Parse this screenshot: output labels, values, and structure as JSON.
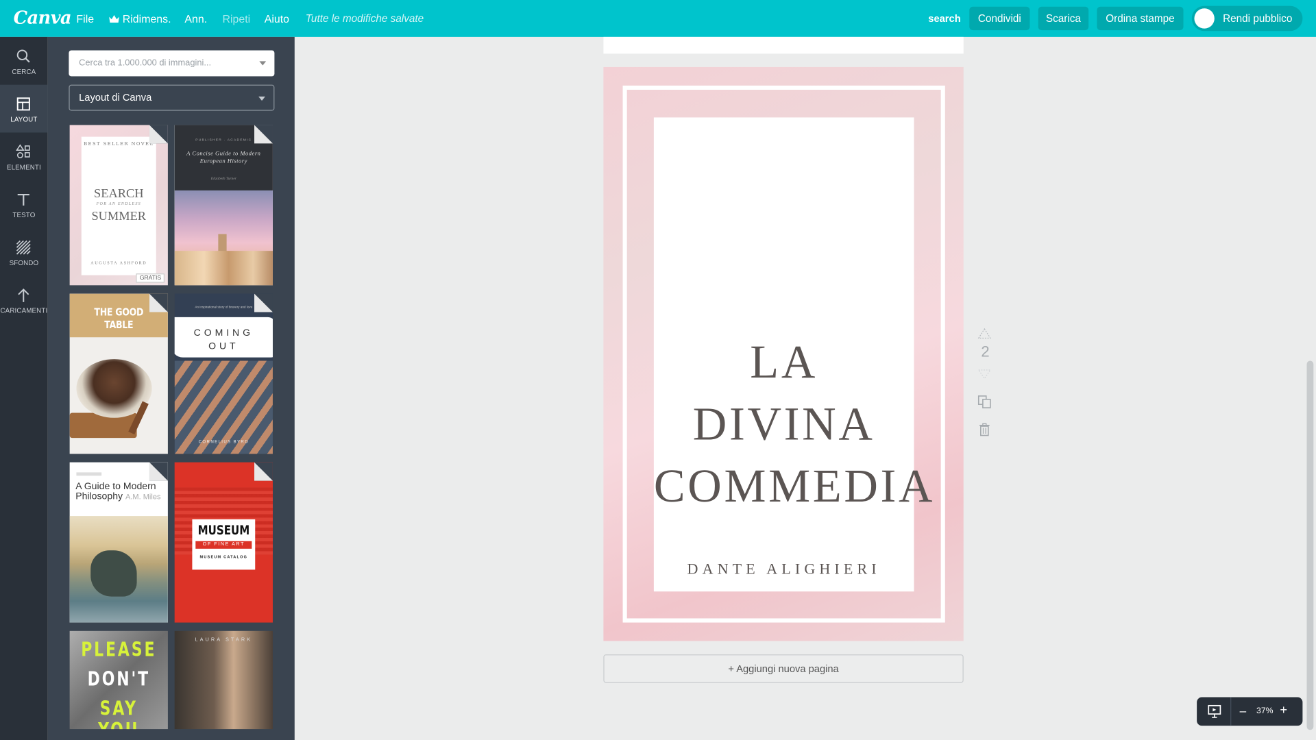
{
  "topbar": {
    "logo": "Canva",
    "menu": [
      "File",
      "Ridimens.",
      "Ann.",
      "Ripeti",
      "Aiuto"
    ],
    "saved_status": "Tutte le modifiche salvate",
    "search_link": "search",
    "share": "Condividi",
    "download": "Scarica",
    "order_prints": "Ordina stampe",
    "make_public": "Rendi pubblico"
  },
  "rail": {
    "items": [
      "CERCA",
      "LAYOUT",
      "ELEMENTI",
      "TESTO",
      "SFONDO",
      "CARICAMENTI"
    ],
    "active": "LAYOUT"
  },
  "panel": {
    "search_placeholder": "Cerca tra 1.000.000 di immagini...",
    "dropdown_value": "Layout di Canva",
    "templates": {
      "t1": {
        "top": "BEST SELLER NOVEL",
        "line1": "SEARCH",
        "sub": "FOR AN ENDLESS",
        "line2": "SUMMER",
        "author": "AUGUSTA ASHFORD",
        "badge": "GRATIS"
      },
      "t2": {
        "pub": "PUBLISHER · ACADEMIC",
        "title": "A Concise Guide to Modern European History",
        "author": "Elizabeth Turner"
      },
      "t3": {
        "title": "THE GOOD TABLE"
      },
      "t4": {
        "tagline": "An inspirational story of bravery and love",
        "title_line1": "COMING",
        "title_line2": "OUT",
        "author": "CORNELIUS BYRD"
      },
      "t5": {
        "title": "A Guide to Modern Philosophy",
        "author": "A.M. Miles"
      },
      "t6": {
        "title": "MUSEUM",
        "sub": "OF FINE ART",
        "catalog": "MUSEUM CATALOG"
      },
      "t7": {
        "line1": "PLEASE",
        "line2": "DON'T",
        "line3": "SAY YOU"
      },
      "t8": {
        "author": "LAURA STARK"
      }
    }
  },
  "canvas": {
    "title_line1": "LA DIVINA",
    "title_line2": "COMMEDIA",
    "author": "DANTE ALIGHIERI",
    "add_page": "+ Aggiungi nuova pagina",
    "page_number": "2"
  },
  "zoom": {
    "level": "37%",
    "minus": "–",
    "plus": "+"
  },
  "colors": {
    "topbar": "#00c4cc",
    "button": "#00a9ae",
    "rail": "#293039",
    "panel": "#3a4450",
    "workspace": "#ebecec"
  }
}
